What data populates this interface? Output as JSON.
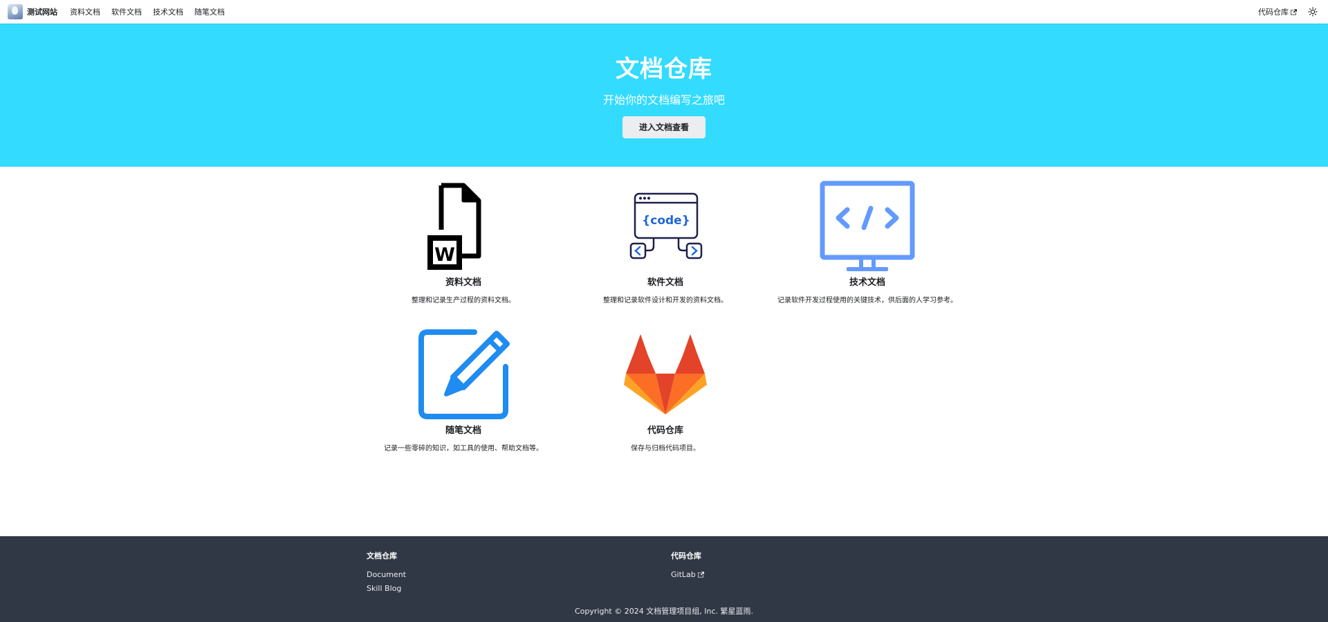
{
  "navbar": {
    "brand_title": "测试网站",
    "items": [
      {
        "label": "资料文档"
      },
      {
        "label": "软件文档"
      },
      {
        "label": "技术文档"
      },
      {
        "label": "随笔文档"
      }
    ],
    "right_link": "代码仓库",
    "theme_icon": "sun-icon"
  },
  "hero": {
    "title": "文档仓库",
    "subtitle": "开始你的文档编写之旅吧",
    "button_label": "进入文档查看",
    "background": "#33dbff"
  },
  "features": [
    {
      "title": "资料文档",
      "description": "整理和记录生产过程的资料文档。",
      "icon": "word-document-icon"
    },
    {
      "title": "软件文档",
      "description": "整理和记录软件设计和开发的资料文档。",
      "icon": "code-window-icon"
    },
    {
      "title": "技术文档",
      "description": "记录软件开发过程使用的关键技术，供后面的人学习参考。",
      "icon": "code-monitor-icon"
    },
    {
      "title": "随笔文档",
      "description": "记录一些零碎的知识，如工具的使用、帮助文档等。",
      "icon": "edit-pencil-icon"
    },
    {
      "title": "代码仓库",
      "description": "保存与归档代码项目。",
      "icon": "gitlab-fox-icon"
    }
  ],
  "footer": {
    "columns": [
      {
        "title": "文档仓库",
        "links": [
          {
            "label": "Document"
          },
          {
            "label": "Skill Blog"
          }
        ]
      },
      {
        "title": "代码仓库",
        "links": [
          {
            "label": "GitLab"
          }
        ]
      }
    ],
    "copyright": "Copyright © 2024 文档管理项目组, Inc. 繁星蓝雨.",
    "background": "#303846"
  }
}
